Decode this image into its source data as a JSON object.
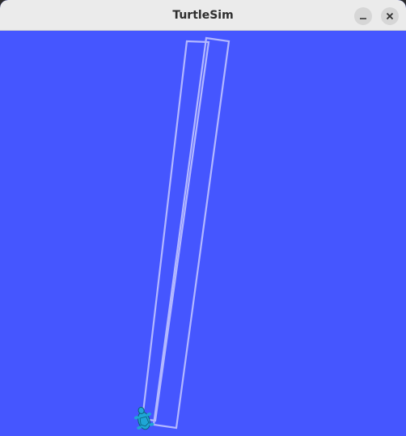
{
  "window": {
    "title": "TurtleSim"
  },
  "titlebar_buttons": {
    "minimize_icon": "minimize-icon",
    "close_icon": "close-icon"
  },
  "canvas": {
    "background_color": "#4556ff",
    "pen_color": "#b3b8ff",
    "turtle_color": "#1fa6d6"
  }
}
